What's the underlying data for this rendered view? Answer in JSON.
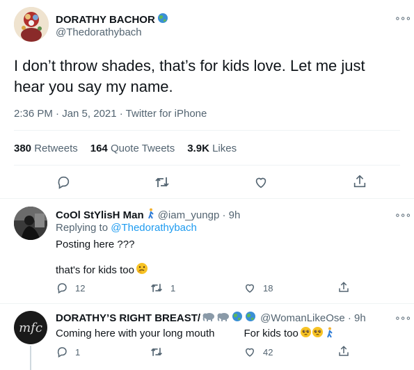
{
  "main_tweet": {
    "display_name": "DORATHY BACHOR",
    "name_emoji": "globe",
    "handle": "@Thedorathybach",
    "text": "I don’t throw shades, that’s for kids love. Let me just hear you say my name.",
    "meta": "2:36 PM · Jan 5, 2021 · Twitter for iPhone",
    "stats": {
      "retweets_count": "380",
      "retweets_label": "Retweets",
      "quotes_count": "164",
      "quotes_label": "Quote Tweets",
      "likes_count": "3.9K",
      "likes_label": "Likes"
    }
  },
  "reply1": {
    "display_name": "CoOl StYlisH Man",
    "name_emoji": "person-walking",
    "handle_time": "@iam_yungp · 9h",
    "replying_to_prefix": "Replying to",
    "replying_to_handle": "@Thedorathybach",
    "line1": "Posting here ???",
    "line2": "that's for kids too",
    "line2_emoji": "thinking-face",
    "reply_count": "12",
    "retweet_count": "1",
    "like_count": "18"
  },
  "reply2": {
    "display_name": "DORATHY’S RIGHT BREAST/",
    "name_emojis": [
      "elephant",
      "elephant",
      "globe",
      "globe"
    ],
    "handle_time": "@WomanLikeOse · 9h",
    "avatar_text": "mfc",
    "text_part1": "Coming here with your long mouth",
    "text_part2": "For kids too",
    "text_emojis": [
      "pleading-face",
      "pleading-face",
      "person-walking"
    ],
    "reply_count": "1",
    "retweet_count": "",
    "like_count": "42"
  },
  "colors": {
    "accent": "#1d9bf0",
    "muted_text": "#536471",
    "divider": "#eff3f4",
    "text": "#0f1419"
  }
}
